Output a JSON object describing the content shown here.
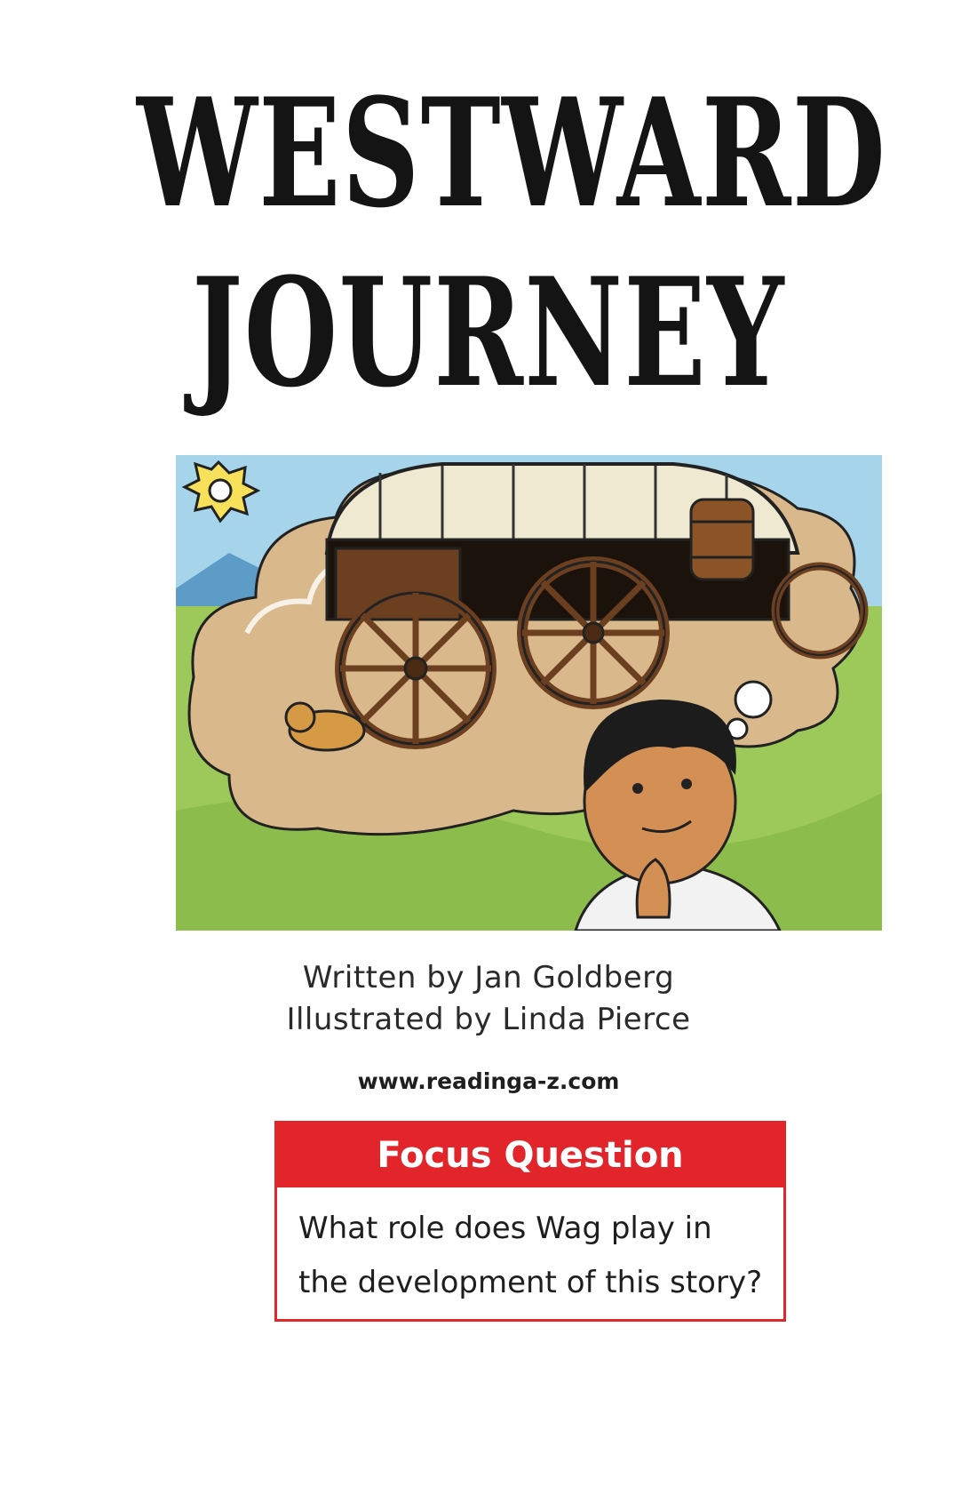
{
  "title": {
    "line1": "WESTWARD",
    "line2": "JOURNEY"
  },
  "credits": {
    "written_by": "Written by  Jan Goldberg",
    "illustrated_by": "Illustrated by Linda Pierce"
  },
  "website": "www.readinga-z.com",
  "focus": {
    "heading": "Focus Question",
    "question": "What role does Wag play in the development of this story?"
  },
  "colors": {
    "accent": "#e2242b",
    "sky": "#9fd0e8",
    "grass": "#9cc95a",
    "dirt": "#d9b98b",
    "wagon": "#6b3f1f"
  }
}
